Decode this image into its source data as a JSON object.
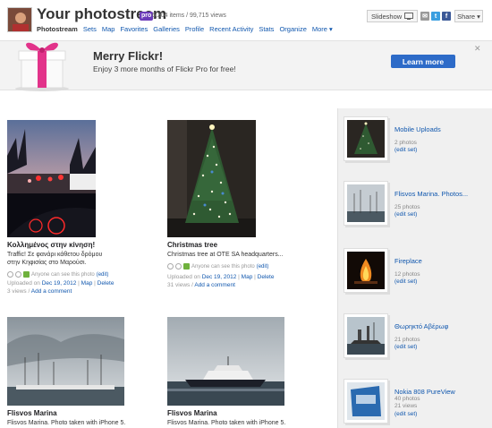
{
  "header": {
    "title": "Your photostream",
    "pro_badge": "pro",
    "counts": "6,204 items / 99,715 views",
    "nav": [
      "Photostream",
      "Sets",
      "Map",
      "Favorites",
      "Galleries",
      "Profile",
      "Recent Activity",
      "Stats",
      "Organize",
      "More ▾"
    ],
    "slideshow_label": "Slideshow",
    "share_label": "Share ▾"
  },
  "banner": {
    "title": "Merry Flickr!",
    "text": "Enjoy 3 more months of Flickr Pro for free!",
    "button_label": "Learn more",
    "close": "✕"
  },
  "photos": [
    {
      "title": "Κολλημένος στην κίνηση!",
      "desc": "Traffic! Σε φανάρι κάθετου δρόμου στην Κηφισίας στο Μαρούσι.",
      "privacy": "Anyone can see this photo",
      "edit": "(edit)",
      "uploaded_prefix": "Uploaded on",
      "date": "Dec 19, 2012",
      "map": "Map",
      "del": "Delete",
      "views": "3 views",
      "add_comment": "Add a comment"
    },
    {
      "title": "Christmas tree",
      "desc": "Christmas tree at OTE SA headquarters...",
      "privacy": "Anyone can see this photo",
      "edit": "(edit)",
      "uploaded_prefix": "Uploaded on",
      "date": "Dec 19, 2012",
      "map": "Map",
      "del": "Delete",
      "views": "31 views",
      "add_comment": "Add a comment"
    },
    {
      "title": "Flisvos Marina",
      "desc": "Flisvos Marina. Photo taken with iPhone 5."
    },
    {
      "title": "Flisvos Marina",
      "desc": "Flisvos Marina. Photo taken with iPhone 5."
    }
  ],
  "sets": [
    {
      "title": "Mobile Uploads",
      "count": "2 photos",
      "edit": "(edit set)"
    },
    {
      "title": "Flisvos Marina. Photos...",
      "count": "25 photos",
      "edit": "(edit set)"
    },
    {
      "title": "Fireplace",
      "count": "12 photos",
      "edit": "(edit set)"
    },
    {
      "title": "Θωρηκτό Αβέρωφ",
      "count": "21 photos",
      "edit": "(edit set)"
    },
    {
      "title": "Nokia 808 PureView",
      "count": "40 photos",
      "views": "21 views",
      "edit": "(edit set)"
    }
  ],
  "colors": {
    "link": "#1057ae",
    "button": "#2d6bc8",
    "pink": "#e2338a",
    "sidebar": "#f0f0f0"
  }
}
